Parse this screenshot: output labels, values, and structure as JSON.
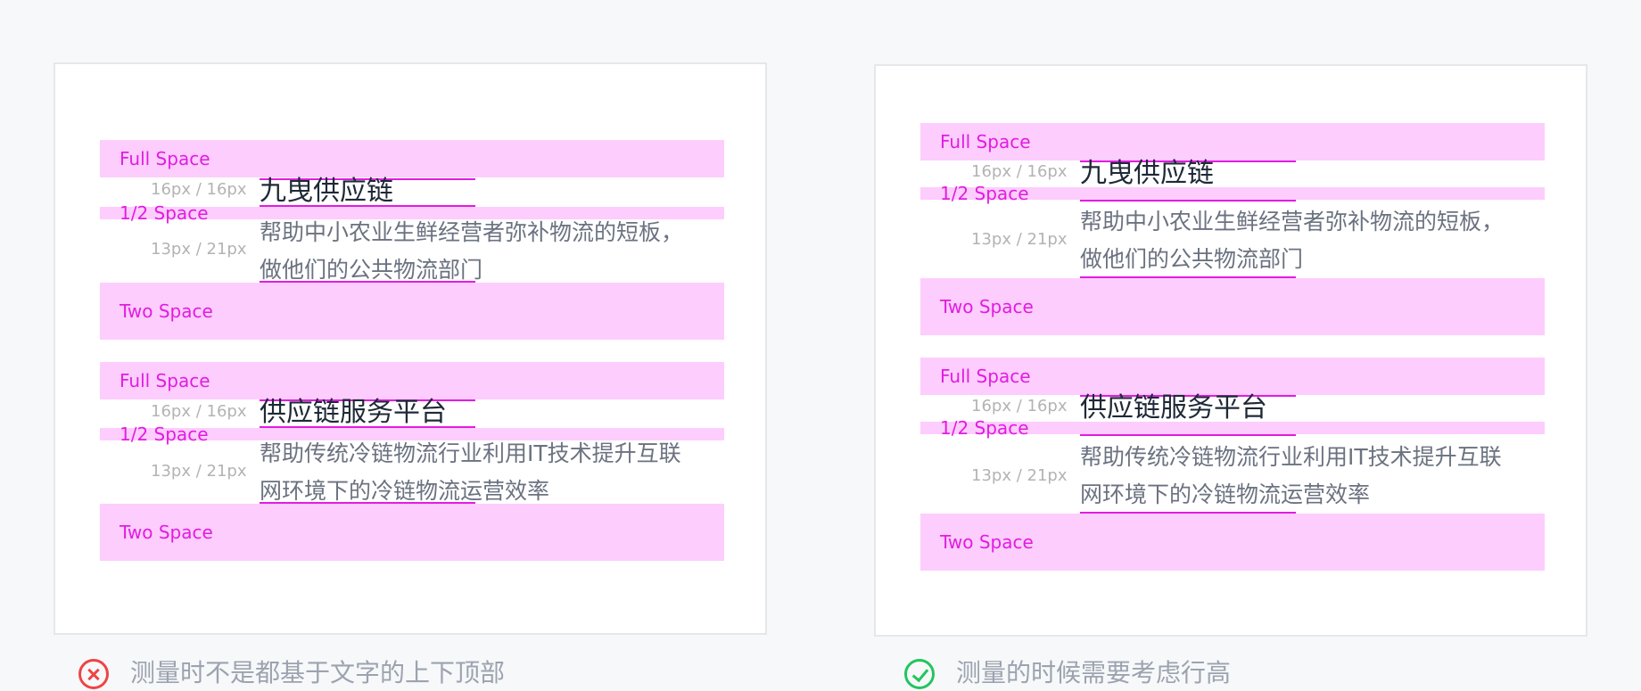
{
  "panels": [
    {
      "blocks": [
        {
          "full_label": "Full Space",
          "half_label": "1/2 Space",
          "two_label": "Two Space",
          "title_meta": "16px / 16px",
          "desc_meta": "13px / 21px",
          "title": "九曳供应链",
          "desc_lines": [
            "帮助中小农业生鲜经营者弥补物流的短板，",
            "做他们的公共物流部门"
          ]
        },
        {
          "full_label": "Full Space",
          "half_label": "1/2 Space",
          "two_label": "Two Space",
          "title_meta": "16px / 16px",
          "desc_meta": "13px / 21px",
          "title": "供应链服务平台",
          "desc_lines": [
            "帮助传统冷链物流行业利用IT技术提升互联",
            "网环境下的冷链物流运营效率"
          ]
        }
      ],
      "caption": "测量时不是都基于文字的上下顶部",
      "caption_icon": "error-x-icon",
      "icon_color": "#ef4444"
    },
    {
      "blocks": [
        {
          "full_label": "Full Space",
          "half_label": "1/2 Space",
          "two_label": "Two Space",
          "title_meta": "16px / 16px",
          "desc_meta": "13px / 21px",
          "title": "九曳供应链",
          "desc_lines": [
            "帮助中小农业生鲜经营者弥补物流的短板，",
            "做他们的公共物流部门"
          ]
        },
        {
          "full_label": "Full Space",
          "half_label": "1/2 Space",
          "two_label": "Two Space",
          "title_meta": "16px / 16px",
          "desc_meta": "13px / 21px",
          "title": "供应链服务平台",
          "desc_lines": [
            "帮助传统冷链物流行业利用IT技术提升互联",
            "网环境下的冷链物流运营效率"
          ]
        }
      ],
      "caption": "测量的时候需要考虑行高",
      "caption_icon": "success-check-icon",
      "icon_color": "#22c55e"
    }
  ],
  "colors": {
    "band": "#fdcdfd",
    "band_label": "#e11ce1",
    "measure_line": "#e11ce1"
  }
}
